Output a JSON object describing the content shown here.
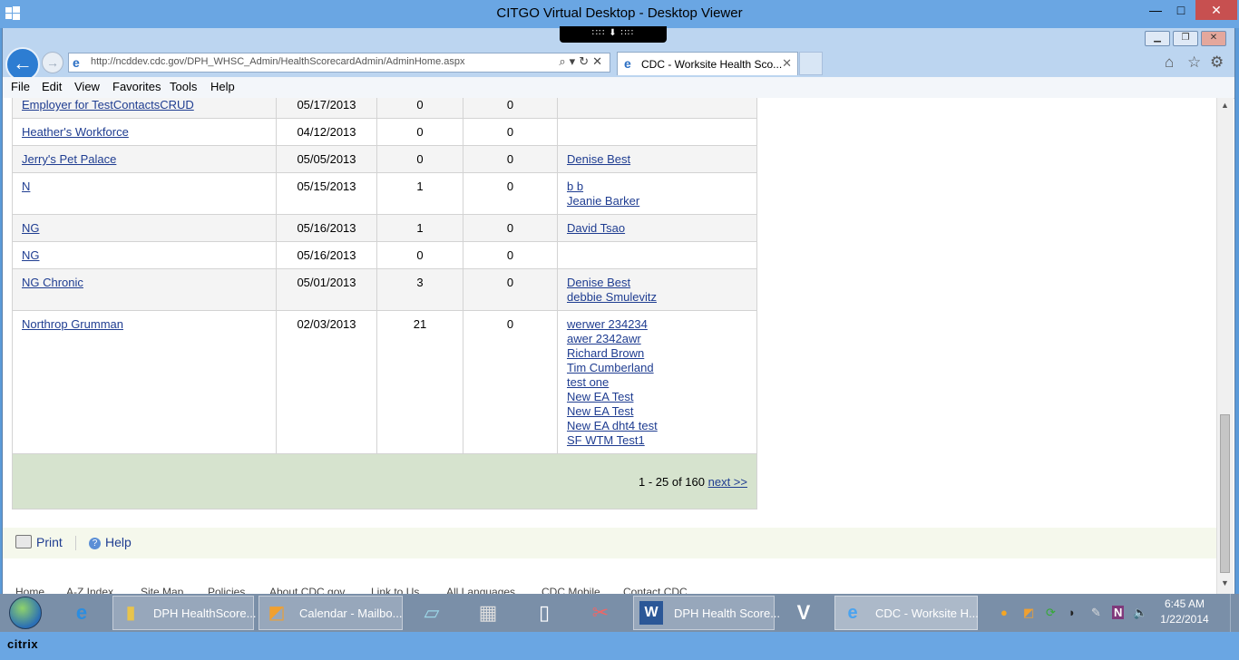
{
  "window": {
    "title": "CITGO Virtual Desktop - Desktop Viewer",
    "min": "—",
    "max": "□",
    "close": "✕",
    "toolbar_handle": "∷∷ ⬇ ∷∷"
  },
  "browser": {
    "url": "http://ncddev.cdc.gov/DPH_WHSC_Admin/HealthScorecardAdmin/AdminHome.aspx",
    "tab_label": "CDC - Worksite Health Sco...",
    "menu": [
      "File",
      "Edit",
      "View",
      "Favorites",
      "Tools",
      "Help"
    ]
  },
  "table": {
    "rows": [
      {
        "name": "Employer for TestContactsCRUD",
        "date": "05/17/2013",
        "col3": "0",
        "col4": "0",
        "contacts": []
      },
      {
        "name": "Heather's Workforce",
        "date": "04/12/2013",
        "col3": "0",
        "col4": "0",
        "contacts": []
      },
      {
        "name": "Jerry's Pet Palace",
        "date": "05/05/2013",
        "col3": "0",
        "col4": "0",
        "contacts": [
          "Denise Best"
        ]
      },
      {
        "name": "N",
        "date": "05/15/2013",
        "col3": "1",
        "col4": "0",
        "contacts": [
          "b b",
          "Jeanie Barker"
        ]
      },
      {
        "name": "NG",
        "date": "05/16/2013",
        "col3": "1",
        "col4": "0",
        "contacts": [
          "David Tsao"
        ]
      },
      {
        "name": "NG",
        "date": "05/16/2013",
        "col3": "0",
        "col4": "0",
        "contacts": []
      },
      {
        "name": "NG Chronic",
        "date": "05/01/2013",
        "col3": "3",
        "col4": "0",
        "contacts": [
          "Denise Best",
          "debbie Smulevitz"
        ]
      },
      {
        "name": "Northrop Grumman",
        "date": "02/03/2013",
        "col3": "21",
        "col4": "0",
        "contacts": [
          "werwer 234234",
          "awer 2342awr",
          "Richard Brown",
          "Tim Cumberland",
          "test one",
          "New EA Test",
          "New EA Test",
          "New EA dht4 test",
          "SF WTM Test1"
        ]
      }
    ],
    "pager": {
      "range": "1 - 25 of 160",
      "next": "next >>"
    }
  },
  "footer": {
    "print": "Print",
    "help": "Help",
    "links": [
      "Home",
      "A-Z Index",
      "Site Map",
      "Policies",
      "About CDC.gov",
      "Link to Us",
      "All Languages",
      "CDC Mobile",
      "Contact CDC"
    ]
  },
  "taskbar": {
    "buttons": [
      {
        "label": "DPH HealthScore...",
        "icon": "folder-icon"
      },
      {
        "label": "Calendar - Mailbo...",
        "icon": "outlook-icon"
      },
      {
        "label": "DPH Health Score...",
        "icon": "word-icon"
      },
      {
        "label": "CDC - Worksite H...",
        "icon": "ie-icon"
      }
    ],
    "time": "6:45 AM",
    "date": "1/22/2014"
  },
  "citrix": {
    "logo": "citrix"
  }
}
